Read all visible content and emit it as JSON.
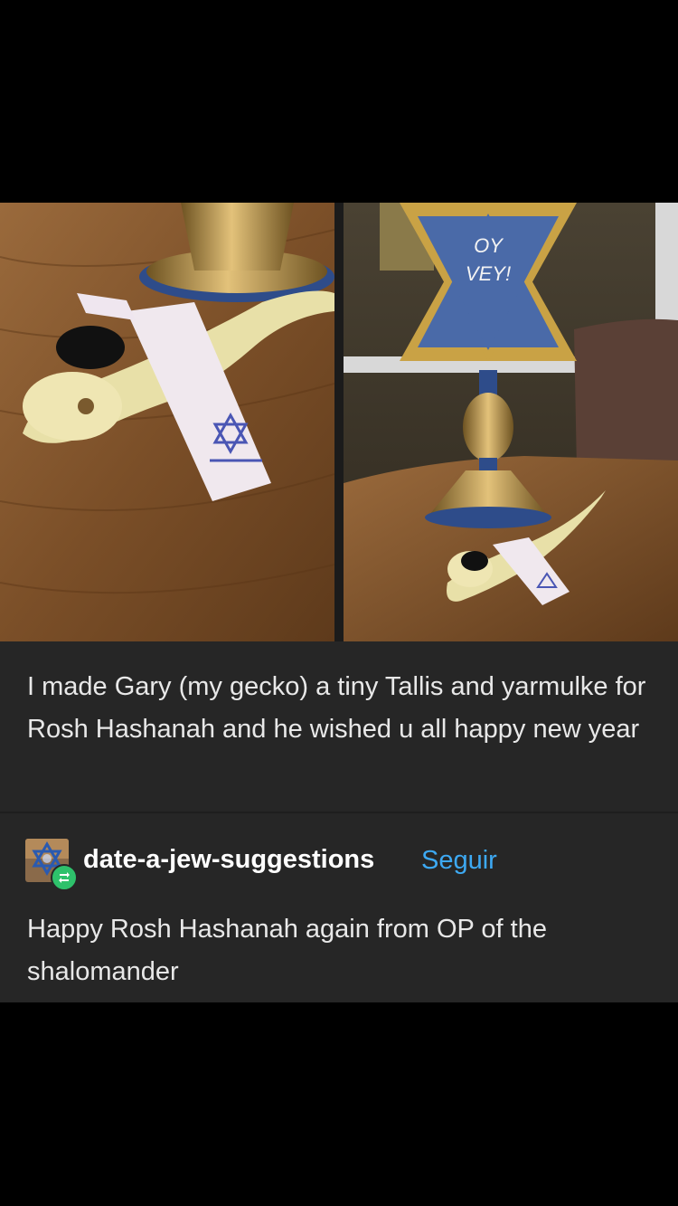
{
  "post": {
    "caption": "I made Gary (my gecko) a tiny Tallis and yarmulke for Rosh Hashanah and he wished u all happy new year",
    "photos": {
      "sign_text_line1": "OY",
      "sign_text_line2": "VEY!"
    }
  },
  "reblog": {
    "username": "date-a-jew-suggestions",
    "follow_label": "Seguir",
    "text": "Happy Rosh Hashanah again from OP of the shalomander",
    "badge_icon": "reblog-icon"
  },
  "colors": {
    "background": "#000000",
    "card": "#262626",
    "text": "#e8e8e8",
    "link": "#3da9f3",
    "badge": "#2ec16b"
  }
}
